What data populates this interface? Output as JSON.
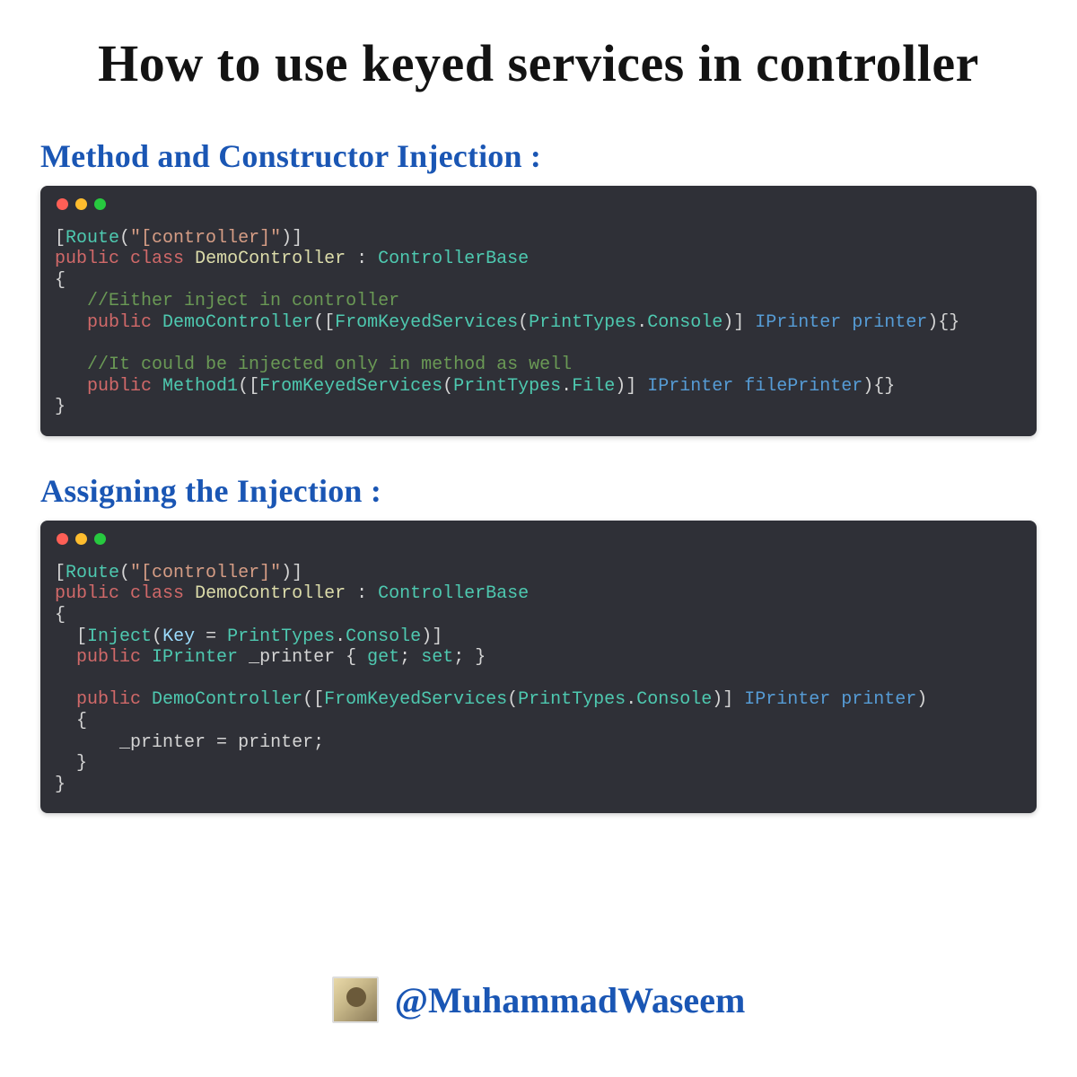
{
  "title": "How to use keyed services in controller",
  "sections": {
    "s1": {
      "title": "Method and Constructor Injection :"
    },
    "s2": {
      "title": "Assigning the Injection :"
    }
  },
  "code1": {
    "route_attr": "Route",
    "route_str": "\"[controller]\"",
    "kw_public": "public",
    "kw_class": "class",
    "class_name": "DemoController",
    "base_class": "ControllerBase",
    "comment1": "//Either inject in controller",
    "ctor": "DemoController",
    "attr_fks": "FromKeyedServices",
    "print_types": "PrintTypes",
    "console": "Console",
    "iprinter": "IPrinter",
    "param_printer": "printer",
    "comment2": "//It could be injected only in method as well",
    "method1": "Method1",
    "file": "File",
    "param_fileprinter": "filePrinter"
  },
  "code2": {
    "route_attr": "Route",
    "route_str": "\"[controller]\"",
    "kw_public": "public",
    "kw_class": "class",
    "class_name": "DemoController",
    "base_class": "ControllerBase",
    "inject": "Inject",
    "key_label": "Key",
    "print_types": "PrintTypes",
    "console": "Console",
    "iprinter": "IPrinter",
    "prop_name": "_printer",
    "kw_get": "get",
    "kw_set": "set",
    "ctor": "DemoController",
    "attr_fks": "FromKeyedServices",
    "param_printer": "printer",
    "assign_left": "_printer",
    "assign_right": "printer"
  },
  "footer": {
    "handle": "@MuhammadWaseem"
  }
}
